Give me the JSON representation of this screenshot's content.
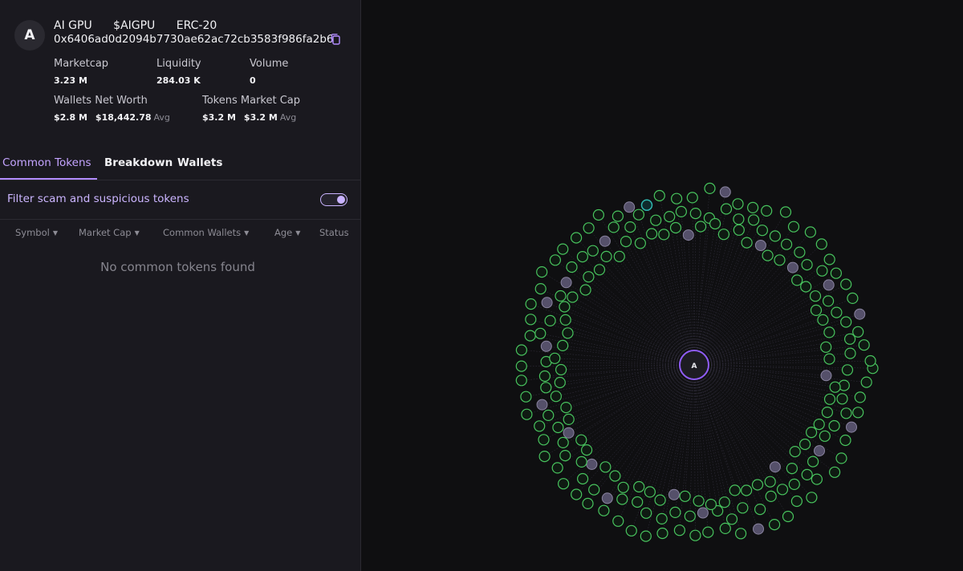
{
  "token": {
    "avatar_letter": "A",
    "name": "AI GPU",
    "symbol": "$AIGPU",
    "standard": "ERC-20",
    "address": "0x6406ad0d2094b7730ae62ac72cb3583f986fa2b6"
  },
  "stats": {
    "marketcap_label": "Marketcap",
    "marketcap_value": "3.23 M",
    "liquidity_label": "Liquidity",
    "liquidity_value": "284.03 K",
    "volume_label": "Volume",
    "volume_value": "0",
    "wallets_net_worth_label": "Wallets Net Worth",
    "wallets_net_worth_total": "$2.8 M",
    "wallets_net_worth_avg": "$18,442.78",
    "tokens_market_cap_label": "Tokens Market Cap",
    "tokens_market_cap_total": "$3.2 M",
    "tokens_market_cap_avg": "$3.2 M",
    "avg_label": "Avg"
  },
  "tabs": [
    "Common Tokens",
    "Breakdown",
    "Wallets"
  ],
  "active_tab": "Common Tokens",
  "filter": {
    "label": "Filter scam and suspicious tokens",
    "enabled": true
  },
  "table": {
    "columns": [
      "Symbol",
      "Market Cap",
      "Common Wallets",
      "Age",
      "Status"
    ],
    "empty_message": "No common tokens found"
  },
  "graph": {
    "center_label": "A",
    "node_counts": {
      "wallet": 182,
      "flagged": 22,
      "highlighted": 1
    },
    "colors": {
      "wallet_stroke": "#48c45e",
      "flagged_fill": "#55506a",
      "highlighted_stroke": "#2fb8b0",
      "center_stroke": "#8f5cf6",
      "edge": "#5a5470"
    }
  },
  "colors": {
    "accent": "#b28cff",
    "panel_bg": "#1a191f",
    "canvas_bg": "#0f0f11"
  }
}
